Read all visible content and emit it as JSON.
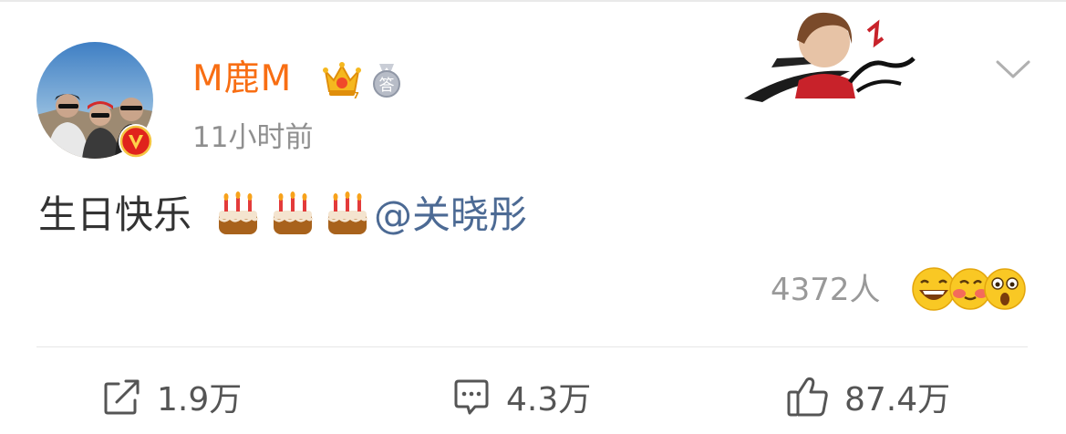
{
  "post": {
    "author": "M鹿M",
    "time": "11小时前",
    "text": "生日快乐",
    "mention": "@关晓彤",
    "reaction_count": "4372人"
  },
  "badges": {
    "crown_icon": "crown-vip-icon",
    "medal_icon": "medal-answer-icon",
    "medal_char": "答",
    "verified_letter": "V"
  },
  "actions": {
    "repost_count": "1.9万",
    "comment_count": "4.3万",
    "like_count": "87.4万"
  },
  "colors": {
    "username": "#f86e13",
    "mention": "#4c6a94",
    "muted": "#999999",
    "verified": "#e0231c"
  }
}
